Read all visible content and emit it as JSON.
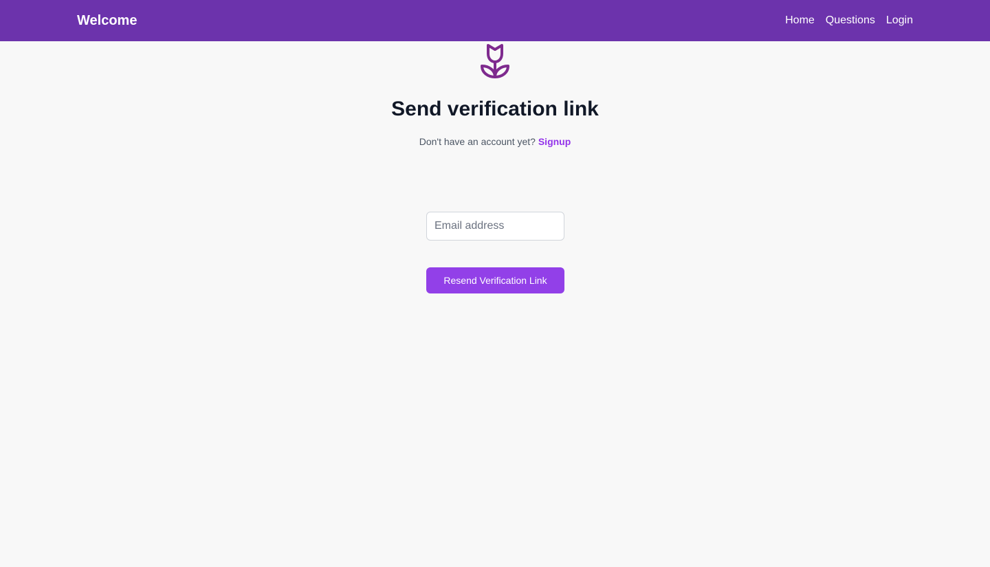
{
  "navbar": {
    "brand": "Welcome",
    "links": [
      {
        "label": "Home"
      },
      {
        "label": "Questions"
      },
      {
        "label": "Login"
      }
    ],
    "background_color": "#6c33ac"
  },
  "logo": {
    "icon": "tulip-icon",
    "color": "#7e2a8e"
  },
  "main": {
    "title": "Send verification link",
    "subtitle_text": "Don't have an account yet?",
    "signup_link": "Signup",
    "email_input": {
      "placeholder": "Email address",
      "value": ""
    },
    "submit_label": "Resend Verification Link",
    "accent_color": "#9333ea"
  }
}
